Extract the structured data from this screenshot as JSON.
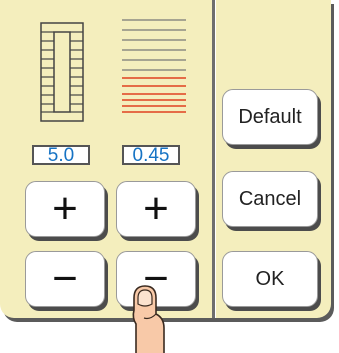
{
  "stitch_width": {
    "value": "5.0",
    "plus_symbol": "+",
    "minus_symbol": "−"
  },
  "stitch_density": {
    "value": "0.45",
    "plus_symbol": "+",
    "minus_symbol": "−"
  },
  "side_buttons": {
    "default_label": "Default",
    "cancel_label": "Cancel",
    "ok_label": "OK"
  },
  "icons": {
    "stitch_width_icon": "satin-stitch-width-icon",
    "density_icon": "stitch-density-lines-icon",
    "pointer": "finger-pointer-icon"
  },
  "colors": {
    "panel": "#f4eebd",
    "value_text": "#1673c4",
    "density_highlight": "#e04020"
  }
}
